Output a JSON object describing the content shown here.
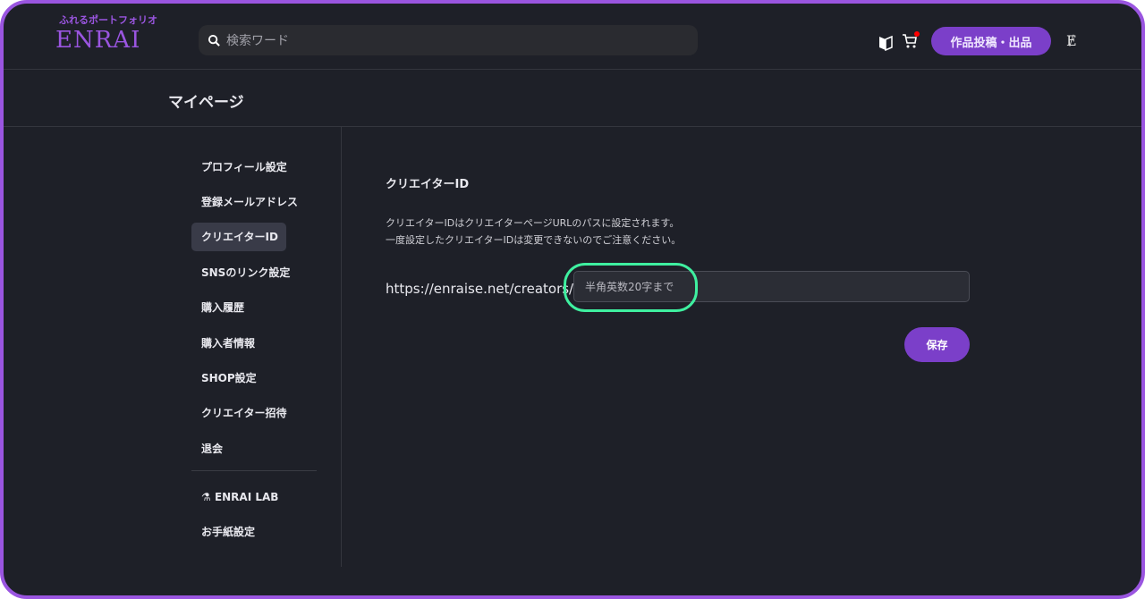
{
  "header": {
    "tagline": "ふれるポートフォリオ",
    "logo": "ENRAI",
    "search_placeholder": "検索ワード",
    "post_button": "作品投稿・出品",
    "avatar_glyph": "Ɇ"
  },
  "page": {
    "title": "マイページ"
  },
  "sidebar": {
    "items": [
      {
        "label": "プロフィール設定"
      },
      {
        "label": "登録メールアドレス"
      },
      {
        "label": "クリエイターID",
        "active": true
      },
      {
        "label": "SNSのリンク設定"
      },
      {
        "label": "購入履歴"
      },
      {
        "label": "購入者情報"
      },
      {
        "label": "SHOP設定"
      },
      {
        "label": "クリエイター招待"
      },
      {
        "label": "退会"
      }
    ],
    "lab": "ENRAI LAB",
    "letter": "お手紙設定"
  },
  "main": {
    "heading": "クリエイターID",
    "desc1": "クリエイターIDはクリエイターページURLのパスに設定されます。",
    "desc2": "一度設定したクリエイターIDは変更できないのでご注意ください。",
    "url_prefix": "https://enraise.net/creators/",
    "id_placeholder": "半角英数20字まで",
    "id_value": "",
    "save": "保存"
  },
  "colors": {
    "accent": "#7b3fc9",
    "highlight": "#3ff0a0",
    "bg": "#1e2028"
  }
}
